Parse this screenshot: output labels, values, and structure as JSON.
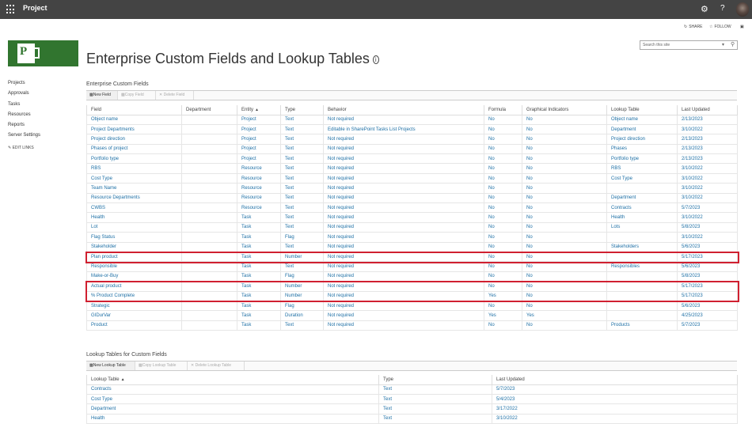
{
  "header": {
    "app_name": "Project",
    "icons": [
      "app-launcher-icon",
      "gear-icon",
      "help-icon",
      "avatar"
    ],
    "share_label": "SHARE",
    "follow_label": "FOLLOW"
  },
  "page": {
    "title": "Enterprise Custom Fields and Lookup Tables",
    "search_placeholder": "Search this site"
  },
  "leftnav": {
    "items": [
      "Projects",
      "Approvals",
      "Tasks",
      "Resources",
      "Reports",
      "Server Settings"
    ],
    "edit_links": "EDIT LINKS"
  },
  "ecf": {
    "section_title": "Enterprise Custom Fields",
    "toolbar": {
      "new": "New Field",
      "copy": "Copy Field",
      "delete": "Delete Field"
    },
    "columns": [
      "Field",
      "Department",
      "Entity",
      "Type",
      "Behavior",
      "Formula",
      "Graphical Indicators",
      "Lookup Table",
      "Last Updated"
    ],
    "rows": [
      [
        "Object name",
        "",
        "Project",
        "Text",
        "Not required",
        "No",
        "No",
        "Object name",
        "2/13/2023"
      ],
      [
        "Project Departments",
        "",
        "Project",
        "Text",
        "Editable in SharePoint Tasks List Projects",
        "No",
        "No",
        "Department",
        "3/10/2022"
      ],
      [
        "Project direction",
        "",
        "Project",
        "Text",
        "Not required",
        "No",
        "No",
        "Project direction",
        "2/13/2023"
      ],
      [
        "Phases of project",
        "",
        "Project",
        "Text",
        "Not required",
        "No",
        "No",
        "Phases",
        "2/13/2023"
      ],
      [
        "Portfolio type",
        "",
        "Project",
        "Text",
        "Not required",
        "No",
        "No",
        "Portfolio type",
        "2/13/2023"
      ],
      [
        "RBS",
        "",
        "Resource",
        "Text",
        "Not required",
        "No",
        "No",
        "RBS",
        "3/10/2022"
      ],
      [
        "Cost Type",
        "",
        "Resource",
        "Text",
        "Not required",
        "No",
        "No",
        "Cost Type",
        "3/10/2022"
      ],
      [
        "Team Name",
        "",
        "Resource",
        "Text",
        "Not required",
        "No",
        "No",
        "",
        "3/10/2022"
      ],
      [
        "Resource Departments",
        "",
        "Resource",
        "Text",
        "Not required",
        "No",
        "No",
        "Department",
        "3/10/2022"
      ],
      [
        "CWBS",
        "",
        "Resource",
        "Text",
        "Not required",
        "No",
        "No",
        "Contracts",
        "5/7/2023"
      ],
      [
        "Health",
        "",
        "Task",
        "Text",
        "Not required",
        "No",
        "No",
        "Health",
        "3/10/2022"
      ],
      [
        "Lot",
        "",
        "Task",
        "Text",
        "Not required",
        "No",
        "No",
        "Lots",
        "5/8/2023"
      ],
      [
        "Flag Status",
        "",
        "Task",
        "Flag",
        "Not required",
        "No",
        "No",
        "",
        "3/10/2022"
      ],
      [
        "Stakeholder",
        "",
        "Task",
        "Text",
        "Not required",
        "No",
        "No",
        "Stakeholders",
        "5/6/2023"
      ],
      [
        "Plan product",
        "",
        "Task",
        "Number",
        "Not required",
        "No",
        "No",
        "",
        "5/17/2023"
      ],
      [
        "Responsible",
        "",
        "Task",
        "Text",
        "Not required",
        "No",
        "No",
        "Responsibles",
        "5/6/2023"
      ],
      [
        "Make-or-Buy",
        "",
        "Task",
        "Flag",
        "Not required",
        "No",
        "No",
        "",
        "5/8/2023"
      ],
      [
        "Actual product",
        "",
        "Task",
        "Number",
        "Not required",
        "No",
        "No",
        "",
        "5/17/2023"
      ],
      [
        "% Product Complete",
        "",
        "Task",
        "Number",
        "Not required",
        "Yes",
        "No",
        "",
        "5/17/2023"
      ],
      [
        "Strategic",
        "",
        "Task",
        "Flag",
        "Not required",
        "No",
        "No",
        "",
        "5/6/2023"
      ],
      [
        "GIDurVar",
        "",
        "Task",
        "Duration",
        "Not required",
        "Yes",
        "Yes",
        "",
        "4/25/2023"
      ],
      [
        "Product",
        "",
        "Task",
        "Text",
        "Not required",
        "No",
        "No",
        "Products",
        "5/7/2023"
      ]
    ]
  },
  "lookup": {
    "section_title": "Lookup Tables for Custom Fields",
    "toolbar": {
      "new": "New Lookup Table",
      "copy": "Copy Lookup Table",
      "delete": "Delete Lookup Table"
    },
    "columns": [
      "Lookup Table",
      "Type",
      "Last Updated"
    ],
    "rows": [
      [
        "Contracts",
        "Text",
        "5/7/2023"
      ],
      [
        "Cost Type",
        "Text",
        "5/4/2023"
      ],
      [
        "Department",
        "Text",
        "3/17/2022"
      ],
      [
        "Health",
        "Text",
        "3/10/2022"
      ]
    ]
  },
  "colors": {
    "topbar": "#444444",
    "link": "#1d6fa5",
    "highlight": "#d02030",
    "logo": "#31752f"
  }
}
